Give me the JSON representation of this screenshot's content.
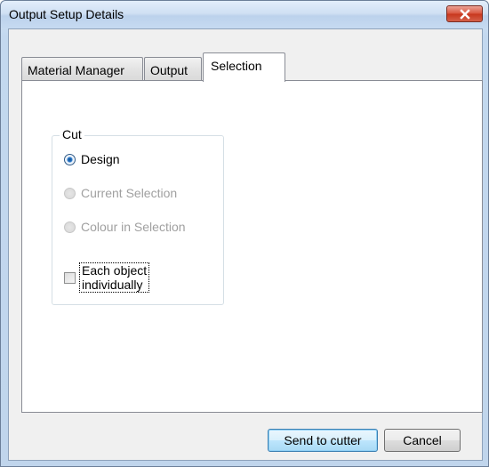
{
  "window": {
    "title": "Output Setup Details",
    "close_icon": "close-x-icon"
  },
  "tabs": [
    {
      "label": "Material Manager",
      "selected": false
    },
    {
      "label": "Output",
      "selected": false
    },
    {
      "label": "Selection",
      "selected": true
    }
  ],
  "cut_group": {
    "title": "Cut",
    "options": [
      {
        "label": "Design",
        "checked": true,
        "enabled": true
      },
      {
        "label": "Current Selection",
        "checked": false,
        "enabled": false
      },
      {
        "label": "Colour in Selection",
        "checked": false,
        "enabled": false
      }
    ],
    "each_object": {
      "line1": "Each object",
      "line2": "individually",
      "checked": false
    }
  },
  "buttons": {
    "send": "Send to cutter",
    "cancel": "Cancel"
  },
  "colors": {
    "title_bar": "#cfe0f3",
    "close_button": "#c7361d",
    "radio_checked": "#2b78c9",
    "disabled_text": "#a0a0a0"
  }
}
